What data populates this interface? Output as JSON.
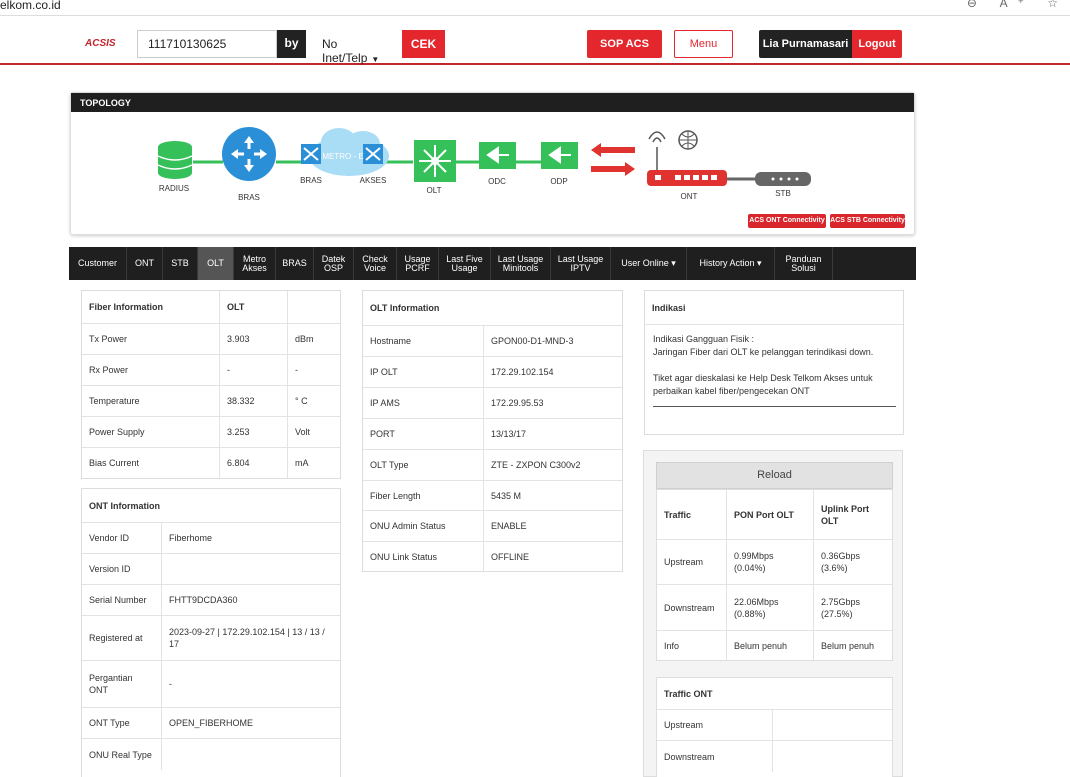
{
  "browser": {
    "url": "elkom.co.id",
    "icons": "⊖ A⁺ ☆"
  },
  "header": {
    "logo": "ACSIS",
    "search_value": "111710130625",
    "by_label": "by",
    "select_value": "No Inet/Telp",
    "cek_label": "CEK",
    "sop_label": "SOP ACS",
    "menu_label": "Menu",
    "user_name": "Lia Purnamasari",
    "logout_label": "Logout"
  },
  "topology": {
    "title": "TOPOLOGY",
    "nodes": [
      "RADIUS",
      "BRAS",
      "BRAS",
      "METRO - E",
      "AKSES",
      "OLT",
      "ODC",
      "ODP",
      "ONT",
      "STB"
    ],
    "buttons": [
      "ACS ONT Connectivity",
      "ACS STB Connectivity"
    ],
    "colors": {
      "green": "#35c05a",
      "blue": "#2b8fd8",
      "red": "#e0322f",
      "gray": "#666666",
      "cloud": "#a9dcf5"
    }
  },
  "tabs": [
    {
      "label": "Customer"
    },
    {
      "label": "ONT"
    },
    {
      "label": "STB"
    },
    {
      "label": "OLT",
      "active": true
    },
    {
      "label": "Metro Akses"
    },
    {
      "label": "BRAS"
    },
    {
      "label": "Datek OSP"
    },
    {
      "label": "Check Voice"
    },
    {
      "label": "Usage PCRF"
    },
    {
      "label": "Last Five Usage"
    },
    {
      "label": "Last Usage Minitools"
    },
    {
      "label": "Last Usage IPTV"
    },
    {
      "label": "User Online ▾"
    },
    {
      "label": "History Action ▾"
    },
    {
      "label": "Panduan Solusi"
    }
  ],
  "fiber": {
    "header": [
      "Fiber Information",
      "OLT",
      ""
    ],
    "rows": [
      [
        "Tx Power",
        "3.903",
        "dBm"
      ],
      [
        "Rx Power",
        "-",
        "-"
      ],
      [
        "Temperature",
        "38.332",
        "° C"
      ],
      [
        "Power Supply",
        "3.253",
        "Volt"
      ],
      [
        "Bias Current",
        "6.804",
        "mA"
      ]
    ]
  },
  "ont": {
    "title": "ONT Information",
    "rows": [
      [
        "Vendor ID",
        "Fiberhome"
      ],
      [
        "Version ID",
        ""
      ],
      [
        "Serial Number",
        "FHTT9DCDA360"
      ],
      [
        "Registered at",
        "2023-09-27 | 172.29.102.154 | 13 / 13 / 17"
      ],
      [
        "Pergantian ONT",
        "-"
      ],
      [
        "ONT Type",
        "OPEN_FIBERHOME"
      ],
      [
        "ONU Real Type",
        ""
      ]
    ]
  },
  "olt": {
    "title": "OLT Information",
    "rows": [
      [
        "Hostname",
        "GPON00-D1-MND-3"
      ],
      [
        "IP OLT",
        "172.29.102.154"
      ],
      [
        "IP AMS",
        "172.29.95.53"
      ],
      [
        "PORT",
        "13/13/17"
      ],
      [
        "OLT Type",
        "ZTE - ZXPON C300v2"
      ],
      [
        "Fiber Length",
        "5435 M"
      ],
      [
        "ONU Admin Status",
        "ENABLE"
      ],
      [
        "ONU Link Status",
        "OFFLINE"
      ]
    ]
  },
  "indikasi": {
    "title": "Indikasi",
    "line1": "Indikasi Gangguan Fisik :",
    "line2": "Jaringan Fiber dari OLT ke pelanggan terindikasi down.",
    "line3": "Tiket agar dieskalasi ke Help Desk Telkom Akses untuk perbaikan kabel fiber/pengecekan ONT"
  },
  "traffic": {
    "reload_label": "Reload",
    "header": [
      "Traffic",
      "PON Port OLT",
      "Uplink Port OLT"
    ],
    "rows": [
      [
        "Upstream",
        "0.99Mbps (0.04%)",
        "0.36Gbps (3.6%)"
      ],
      [
        "Downstream",
        "22.06Mbps (0.88%)",
        "2.75Gbps (27.5%)"
      ],
      [
        "Info",
        "Belum penuh",
        "Belum penuh"
      ]
    ]
  },
  "traffic_ont": {
    "title": "Traffic ONT",
    "rows": [
      [
        "Upstream",
        ""
      ],
      [
        "Downstream",
        ""
      ]
    ]
  }
}
